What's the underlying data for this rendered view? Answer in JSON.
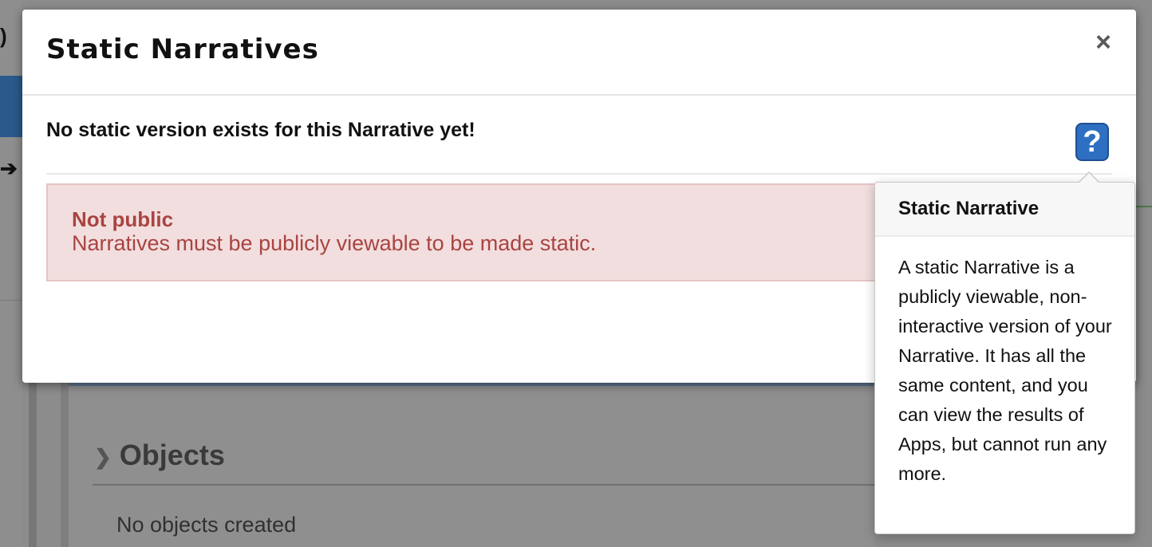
{
  "background": {
    "left_paren": ")",
    "left_arrow": "➔",
    "objects_heading": "Objects",
    "no_objects_text": "No objects created"
  },
  "modal": {
    "title": "Static Narratives",
    "close_glyph": "×",
    "subheading": "No static version exists for this Narrative yet!",
    "help_glyph": "?",
    "alert": {
      "title": "Not public",
      "message": "Narratives must be publicly viewable to be made static."
    }
  },
  "popover": {
    "title": "Static Narrative",
    "body": "A static Narrative is a publicly viewable, non-interactive version of your Narrative. It has all the same content, and you can view the results of Apps, but cannot run any more."
  },
  "colors": {
    "alert_bg": "#f2dede",
    "alert_text": "#a94442",
    "help_icon": "#2f6fc2"
  }
}
